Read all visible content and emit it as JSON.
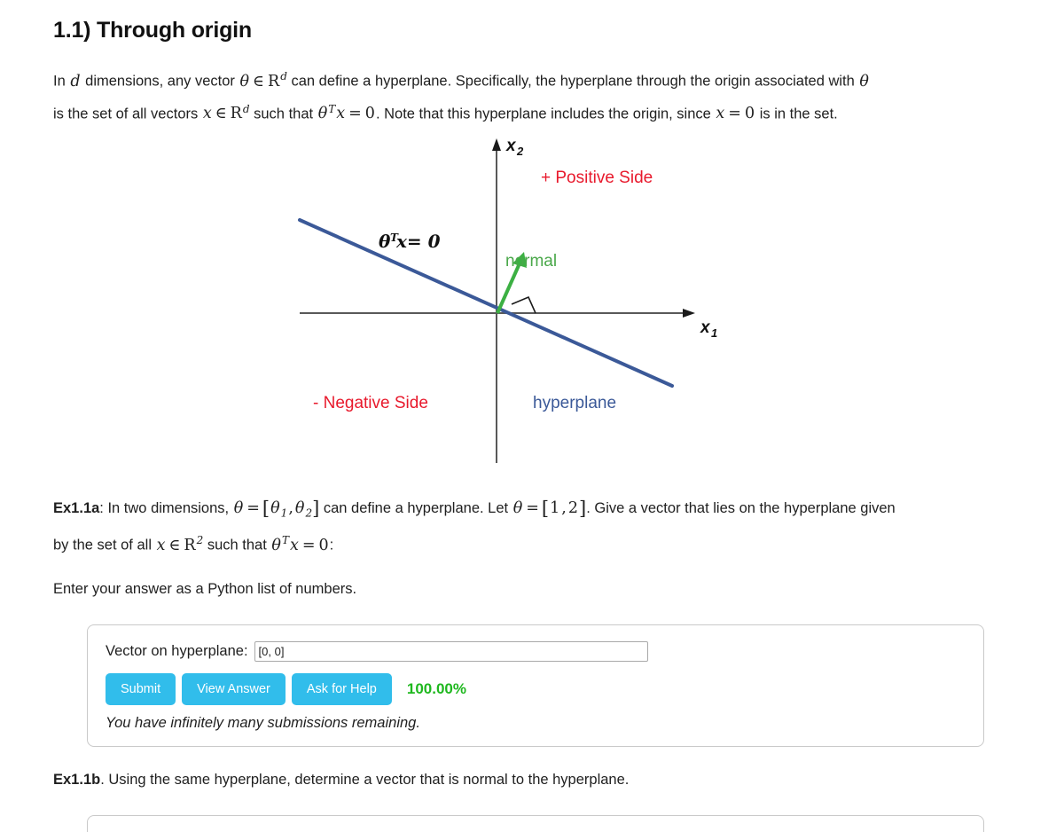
{
  "section": {
    "title": "1.1) Through origin"
  },
  "intro": {
    "run1": "In ",
    "var_d": "d",
    "run2": " dimensions, any vector ",
    "var_theta": "θ",
    "in1": "∈",
    "R1": "R",
    "R1_sup": "d",
    "run3": " can define a hyperplane. Specifically, the hyperplane through the origin associated with ",
    "var_theta2": "θ",
    "run4": "is the set of all vectors ",
    "var_x": "x",
    "in2": "∈",
    "R2": "R",
    "R2_sup": "d",
    "run5": " such that ",
    "theta3": "θ",
    "theta3_sup": "T",
    "var_x2": "x",
    "eq1": "=",
    "zero1": "0",
    "run6": ". Note that this hyperplane includes the origin, since ",
    "var_x3": "x",
    "eq2": "=",
    "zero2": "0",
    "run7": " is in the set."
  },
  "figure": {
    "name": "hyperplane-through-origin-diagram",
    "axis_x_label": "x",
    "axis_x_sub": "1",
    "axis_y_label": "x",
    "axis_y_sub": "2",
    "positive_side": "+ Positive Side",
    "negative_side": "- Negative Side",
    "normal_label": "normal",
    "hyperplane_label": "hyperplane",
    "equation_theta": "θ",
    "equation_sup": "T",
    "equation_rest": "x= 0",
    "colors": {
      "hyperplane": "#3b5998",
      "normal": "#3cb043",
      "positive": "#e8192c",
      "negative": "#e8192c",
      "axis": "#595959"
    }
  },
  "ex_a": {
    "label": "Ex1.1a",
    "run1": ": In two dimensions, ",
    "theta": "θ",
    "eq1": "=",
    "lb1": "[",
    "theta1": "θ",
    "theta1_sub": "1",
    "comma1": ",",
    "theta2": "θ",
    "theta2_sub": "2",
    "rb1": "]",
    "run2": " can define a hyperplane. Let ",
    "theta3": "θ",
    "eq2": "=",
    "lb2": "[",
    "one": "1",
    "comma2": ",",
    "two": "2",
    "rb2": "]",
    "run3": ". Give a vector that lies on the hyperplane given",
    "run4": "by the set of all ",
    "var_x": "x",
    "in": "∈",
    "R": "R",
    "R_sup": "2",
    "run5": " such that ",
    "theta4": "θ",
    "theta4_sup": "T",
    "var_x2": "x",
    "eq3": "=",
    "zero": "0",
    "run6": ":",
    "instruction": "Enter your answer as a Python list of numbers."
  },
  "answer_card_a": {
    "field_label": "Vector on hyperplane:",
    "input_value": "[0, 0]",
    "input_placeholder": "",
    "buttons": [
      {
        "name": "submit-button",
        "label": "Submit"
      },
      {
        "name": "view-answer-button",
        "label": "View Answer"
      },
      {
        "name": "ask-for-help-button",
        "label": "Ask for Help"
      }
    ],
    "score": "100.00%",
    "score_color": "#1fb81f",
    "submissions_note": "You have infinitely many submissions remaining."
  },
  "ex_b": {
    "label": "Ex1.1b",
    "text": ". Using the same hyperplane, determine a vector that is normal to the hyperplane."
  }
}
